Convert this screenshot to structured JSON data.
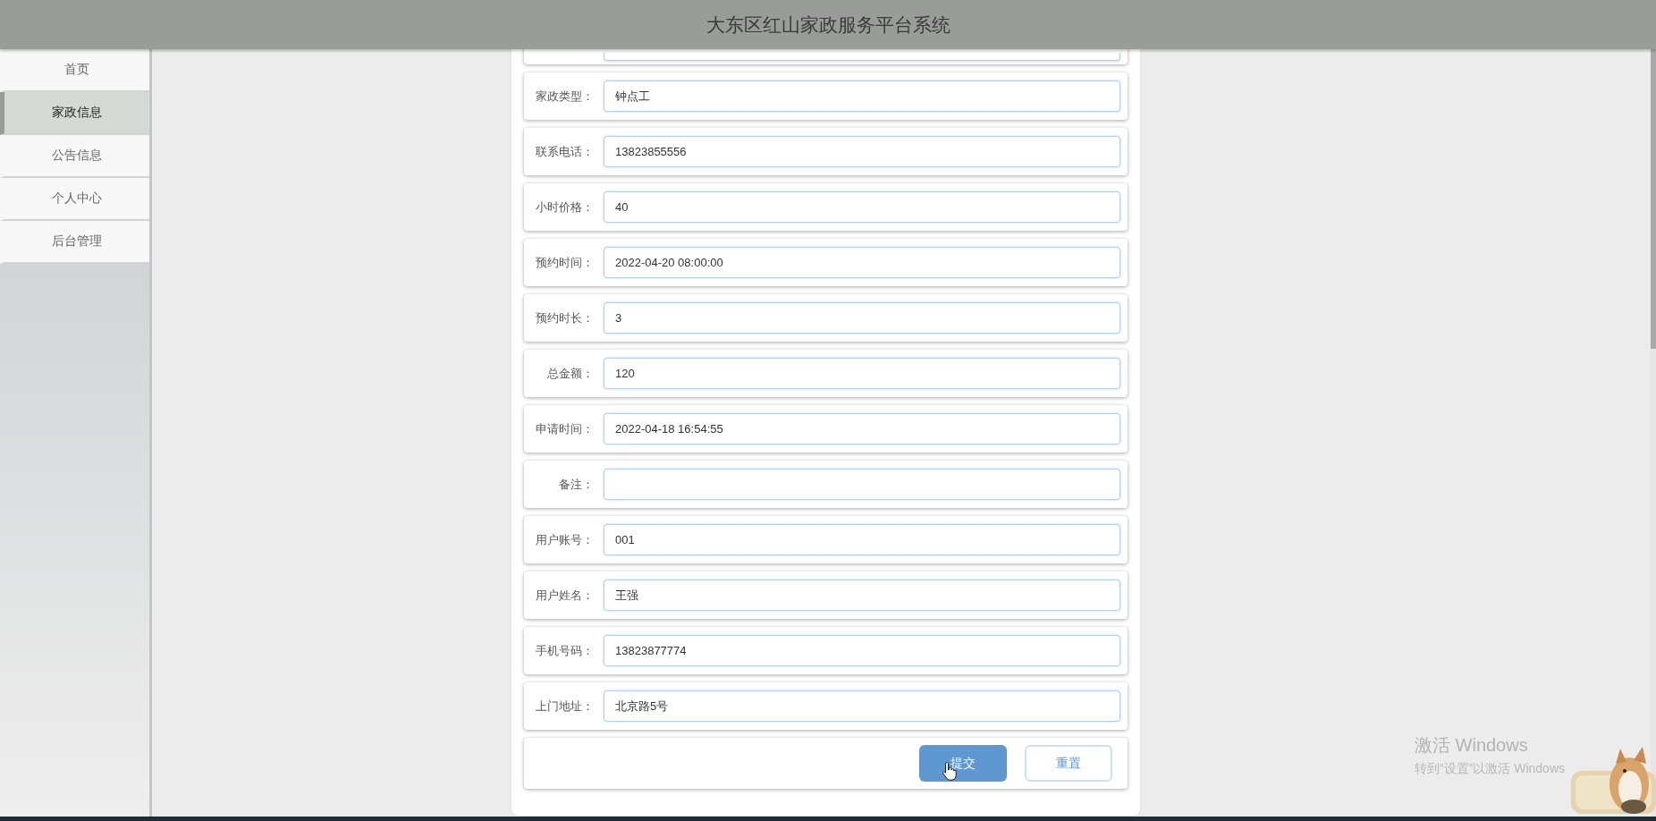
{
  "header": {
    "title": "大东区红山家政服务平台系统"
  },
  "sidebar": {
    "items": [
      {
        "label": "首页",
        "selected": false
      },
      {
        "label": "家政信息",
        "selected": true
      },
      {
        "label": "公告信息",
        "selected": false
      },
      {
        "label": "个人中心",
        "selected": false
      },
      {
        "label": "后台管理",
        "selected": false
      }
    ]
  },
  "form": {
    "fields": [
      {
        "label": "家政类型：",
        "value": "钟点工"
      },
      {
        "label": "联系电话：",
        "value": "13823855556"
      },
      {
        "label": "小时价格：",
        "value": "40"
      },
      {
        "label": "预约时间：",
        "value": "2022-04-20 08:00:00"
      },
      {
        "label": "预约时长：",
        "value": "3"
      },
      {
        "label": "总金额：",
        "value": "120"
      },
      {
        "label": "申请时间：",
        "value": "2022-04-18 16:54:55"
      },
      {
        "label": "备注："
      },
      {
        "label": "用户账号：",
        "value": "001"
      },
      {
        "label": "用户姓名：",
        "value": "王强"
      },
      {
        "label": "手机号码：",
        "value": "13823877774"
      },
      {
        "label": "上门地址：",
        "value": "北京路5号"
      }
    ],
    "buttons": [
      {
        "label": "提交",
        "kind": "primary"
      },
      {
        "label": "重置",
        "kind": "secondary"
      }
    ]
  },
  "activation_notice": {
    "title": "激活 Windows",
    "subtitle": "转到“设置”以激活 Windows"
  }
}
